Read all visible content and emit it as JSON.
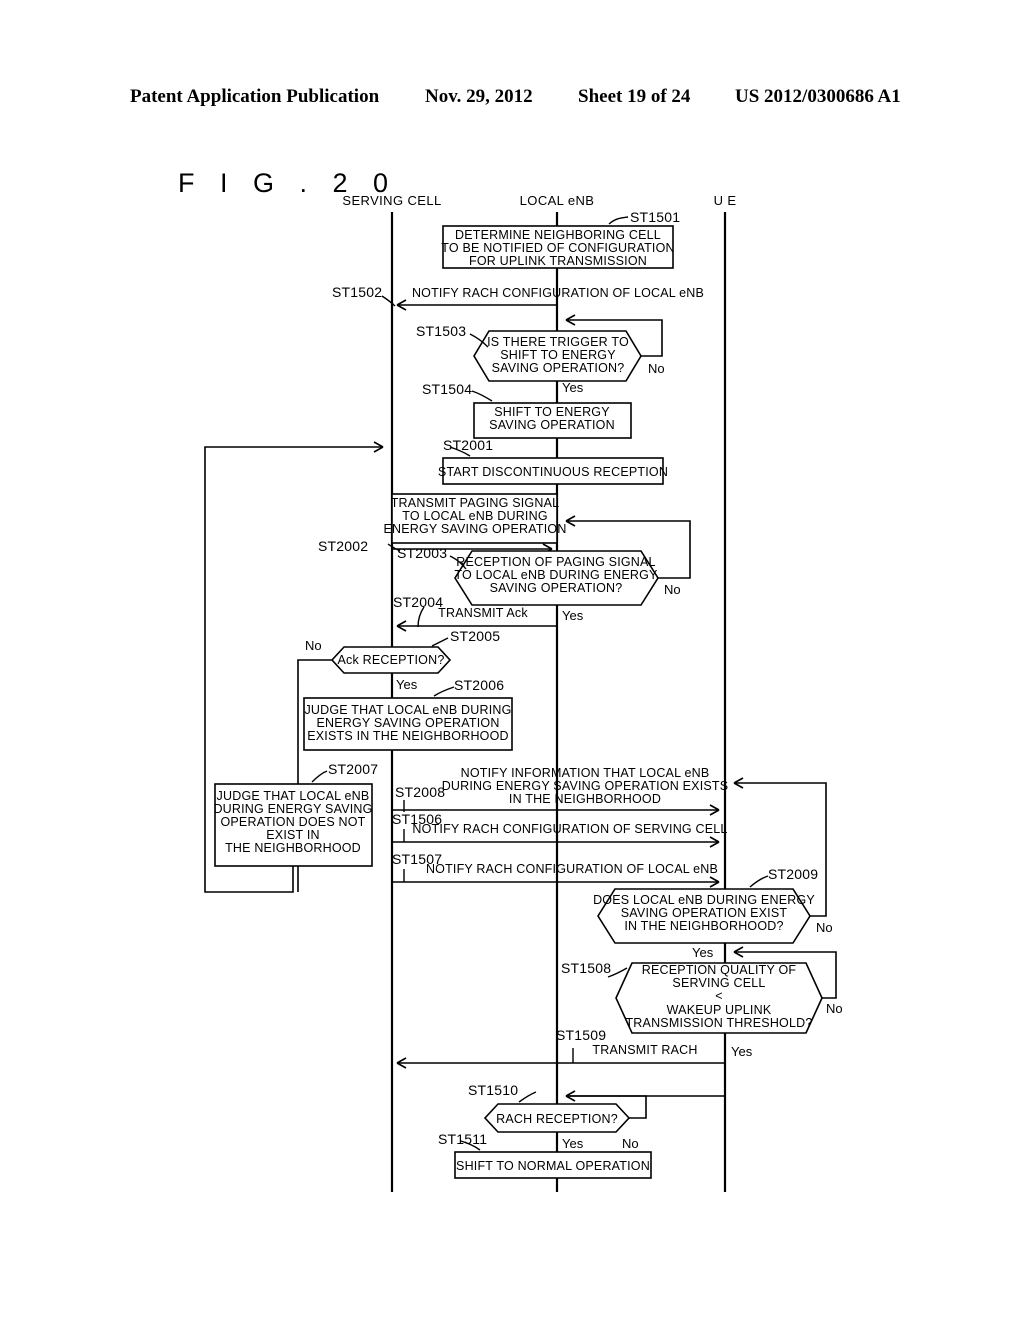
{
  "header": {
    "title": "Patent Application Publication",
    "date": "Nov. 29, 2012",
    "sheet": "Sheet 19 of 24",
    "publication_number": "US 2012/0300686 A1"
  },
  "figure": {
    "label": "F I G .   2 0",
    "type": "sequence-flow-diagram"
  },
  "lanes": [
    {
      "id": "serving-cell",
      "label": "SERVING CELL"
    },
    {
      "id": "local-enb",
      "label": "LOCAL eNB"
    },
    {
      "id": "ue",
      "label": "U E"
    }
  ],
  "labels": {
    "yes": "Yes",
    "no": "No"
  },
  "steps": [
    {
      "id": "ST1501",
      "kind": "process",
      "lane": "local-enb",
      "lines": [
        "DETERMINE NEIGHBORING CELL",
        "TO BE NOTIFIED OF CONFIGURATION",
        "FOR UPLINK TRANSMISSION"
      ]
    },
    {
      "id": "ST1502",
      "kind": "message",
      "from": "local-enb",
      "to": "serving-cell",
      "lines": [
        "NOTIFY RACH CONFIGURATION OF LOCAL eNB"
      ]
    },
    {
      "id": "ST1503",
      "kind": "decision",
      "lane": "local-enb",
      "lines": [
        "IS THERE TRIGGER TO",
        "SHIFT TO ENERGY",
        "SAVING OPERATION?"
      ]
    },
    {
      "id": "ST1504",
      "kind": "process",
      "lane": "local-enb",
      "lines": [
        "SHIFT TO ENERGY",
        "SAVING OPERATION"
      ]
    },
    {
      "id": "ST2001",
      "kind": "process",
      "lane": "local-enb",
      "lines": [
        "START DISCONTINUOUS RECEPTION"
      ]
    },
    {
      "id": "ST2002",
      "kind": "process-message",
      "from": "serving-cell",
      "to": "local-enb",
      "lines": [
        "TRANSMIT PAGING SIGNAL",
        "TO LOCAL eNB DURING",
        "ENERGY SAVING OPERATION"
      ]
    },
    {
      "id": "ST2003",
      "kind": "decision",
      "lane": "local-enb",
      "lines": [
        "RECEPTION OF PAGING SIGNAL",
        "TO LOCAL eNB DURING ENERGY",
        "SAVING OPERATION?"
      ]
    },
    {
      "id": "ST2004",
      "kind": "message",
      "from": "local-enb",
      "to": "serving-cell",
      "lines": [
        "TRANSMIT Ack"
      ]
    },
    {
      "id": "ST2005",
      "kind": "decision",
      "lane": "serving-cell",
      "lines": [
        "Ack RECEPTION?"
      ]
    },
    {
      "id": "ST2006",
      "kind": "process",
      "lane": "serving-cell",
      "lines": [
        "JUDGE THAT LOCAL eNB DURING",
        "ENERGY SAVING OPERATION",
        "EXISTS IN THE NEIGHBORHOOD"
      ]
    },
    {
      "id": "ST2007",
      "kind": "process",
      "lane": "serving-cell-left",
      "lines": [
        "JUDGE THAT LOCAL eNB",
        "DURING ENERGY SAVING",
        "OPERATION DOES NOT",
        "EXIST IN",
        "THE NEIGHBORHOOD"
      ]
    },
    {
      "id": "ST2008",
      "kind": "message",
      "from": "serving-cell",
      "to": "ue",
      "lines": [
        "NOTIFY INFORMATION THAT LOCAL eNB",
        "DURING ENERGY SAVING OPERATION EXISTS",
        "IN THE NEIGHBORHOOD"
      ]
    },
    {
      "id": "ST1506",
      "kind": "message",
      "from": "serving-cell",
      "to": "ue",
      "lines": [
        "NOTIFY RACH CONFIGURATION OF SERVING CELL"
      ]
    },
    {
      "id": "ST1507",
      "kind": "message",
      "from": "serving-cell",
      "to": "ue",
      "lines": [
        "NOTIFY RACH CONFIGURATION OF LOCAL eNB"
      ]
    },
    {
      "id": "ST2009",
      "kind": "decision",
      "lane": "ue",
      "lines": [
        "DOES LOCAL eNB DURING ENERGY",
        "SAVING OPERATION EXIST",
        "IN THE NEIGHBORHOOD?"
      ]
    },
    {
      "id": "ST1508",
      "kind": "decision",
      "lane": "ue",
      "lines": [
        "RECEPTION QUALITY OF",
        "SERVING CELL",
        "<",
        "WAKEUP UPLINK",
        "TRANSMISSION THRESHOLD?"
      ]
    },
    {
      "id": "ST1509",
      "kind": "message",
      "from": "ue",
      "to": "serving-cell",
      "lines": [
        "TRANSMIT RACH"
      ]
    },
    {
      "id": "ST1510",
      "kind": "decision",
      "lane": "local-enb",
      "lines": [
        "RACH RECEPTION?"
      ]
    },
    {
      "id": "ST1511",
      "kind": "process",
      "lane": "local-enb",
      "lines": [
        "SHIFT TO NORMAL OPERATION"
      ]
    }
  ]
}
